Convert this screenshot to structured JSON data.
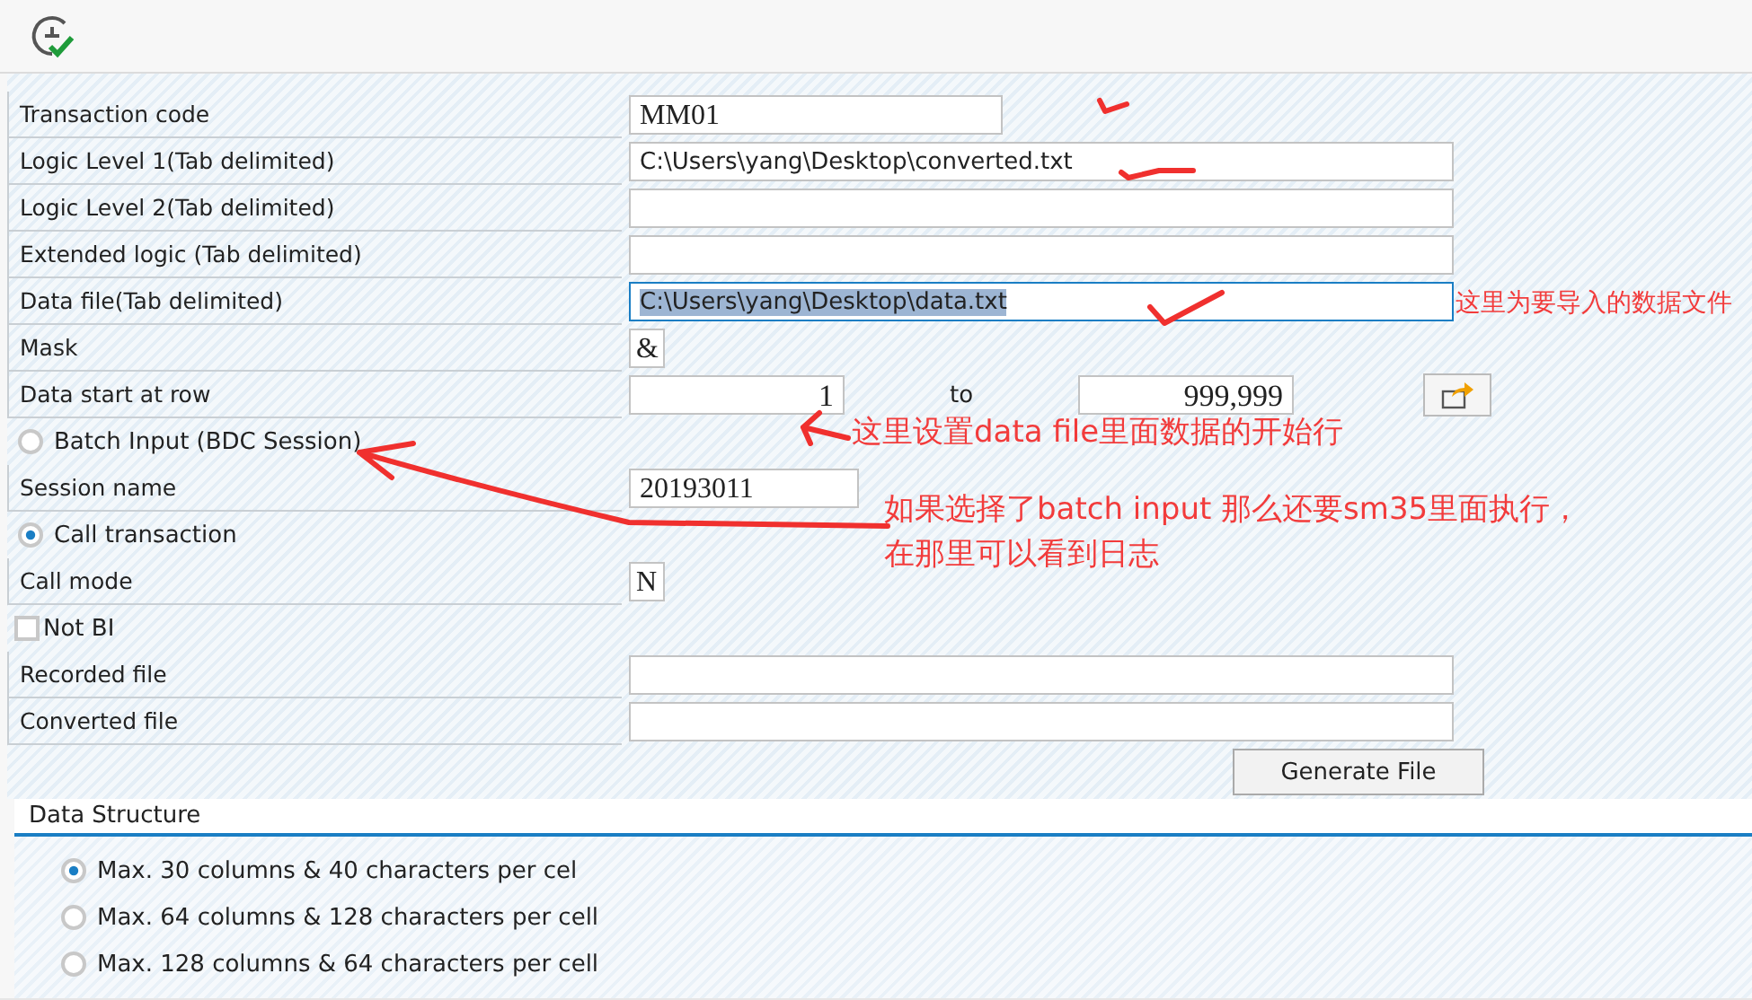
{
  "form": {
    "rows": [
      {
        "kind": "code",
        "label": "Transaction code",
        "value": "MM01"
      },
      {
        "kind": "path",
        "label": "Logic Level 1(Tab delimited)",
        "value": "C:\\Users\\yang\\Desktop\\converted.txt",
        "focused": false
      },
      {
        "kind": "path",
        "label": "Logic Level 2(Tab delimited)",
        "focused": false
      },
      {
        "kind": "path",
        "label": "Extended logic (Tab delimited)",
        "focused": false
      },
      {
        "kind": "path",
        "label": "Data file(Tab delimited)",
        "value": "C:\\Users\\yang\\Desktop\\data.txt",
        "focused": true
      },
      {
        "kind": "char",
        "label": "Mask",
        "value": "&"
      },
      {
        "kind": "range",
        "label": "Data start at row",
        "value": "1",
        "to_label": "to",
        "to_value": "999,999"
      },
      {
        "kind": "radio",
        "label": "Batch Input (BDC Session)",
        "selected": false
      },
      {
        "kind": "code",
        "label": "Session name",
        "value": "20193011"
      },
      {
        "kind": "radio",
        "label": "Call transaction",
        "selected": true
      },
      {
        "kind": "char",
        "label": "Call mode",
        "value": "N"
      },
      {
        "kind": "checkbox",
        "label": "Not BI",
        "checked": false
      },
      {
        "kind": "path",
        "label": "Recorded file",
        "focused": false
      },
      {
        "kind": "path",
        "label": "Converted file",
        "focused": false
      }
    ]
  },
  "generate_button": "Generate File",
  "data_structure": {
    "title": "Data Structure",
    "options": [
      {
        "label": "Max. 30 columns & 40 characters per cel",
        "selected": true
      },
      {
        "label": "Max. 64 columns & 128 characters per cell",
        "selected": false
      },
      {
        "label": "Max. 128 columns & 64 characters per cell",
        "selected": false
      }
    ]
  },
  "annotations": [
    {
      "lines": [
        "这里为要导入的数据文件"
      ]
    },
    {
      "lines": [
        "这里设置data file里面数据的开始行"
      ]
    },
    {
      "lines": [
        "如果选择了batch input 那么还要sm35里面执行，",
        "在那里可以看到日志"
      ]
    }
  ]
}
